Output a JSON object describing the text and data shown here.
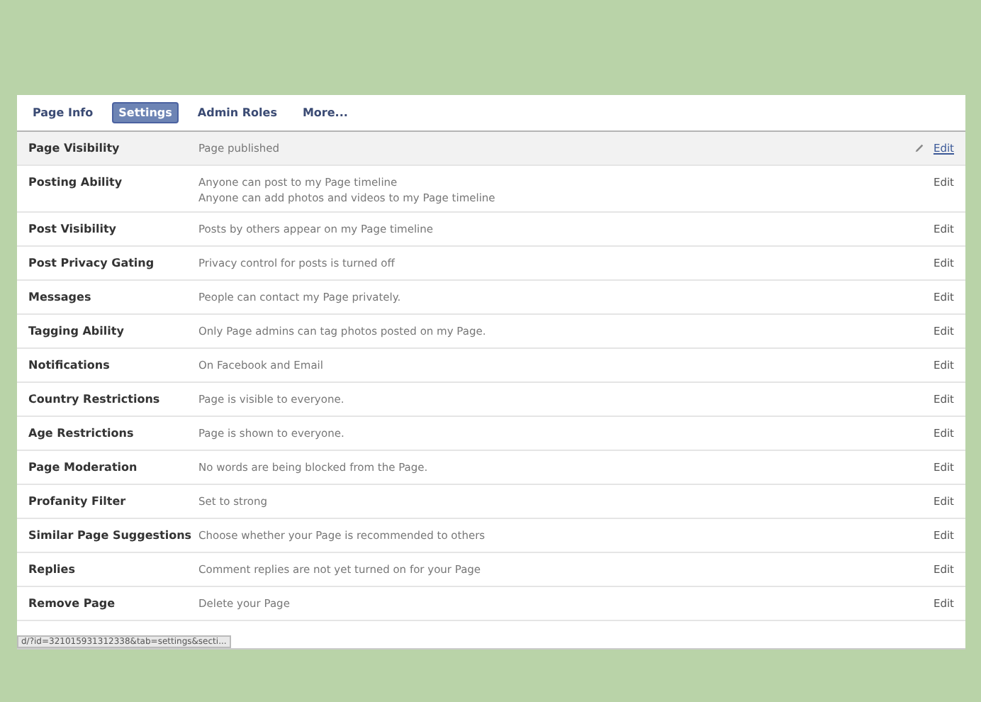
{
  "tabs": [
    {
      "label": "Page Info",
      "selected": false
    },
    {
      "label": "Settings",
      "selected": true
    },
    {
      "label": "Admin Roles",
      "selected": false
    },
    {
      "label": "More...",
      "selected": false
    }
  ],
  "settings": [
    {
      "name": "Page Visibility",
      "lines": [
        "Page published"
      ],
      "action": "Edit",
      "hovered": true
    },
    {
      "name": "Posting Ability",
      "lines": [
        "Anyone can post to my Page timeline",
        "Anyone can add photos and videos to my Page timeline"
      ],
      "action": "Edit",
      "hovered": false
    },
    {
      "name": "Post Visibility",
      "lines": [
        "Posts by others appear on my Page timeline"
      ],
      "action": "Edit",
      "hovered": false
    },
    {
      "name": "Post Privacy Gating",
      "lines": [
        "Privacy control for posts is turned off"
      ],
      "action": "Edit",
      "hovered": false
    },
    {
      "name": "Messages",
      "lines": [
        "People can contact my Page privately."
      ],
      "action": "Edit",
      "hovered": false
    },
    {
      "name": "Tagging Ability",
      "lines": [
        "Only Page admins can tag photos posted on my Page."
      ],
      "action": "Edit",
      "hovered": false
    },
    {
      "name": "Notifications",
      "lines": [
        "On Facebook and Email"
      ],
      "action": "Edit",
      "hovered": false
    },
    {
      "name": "Country Restrictions",
      "lines": [
        "Page is visible to everyone."
      ],
      "action": "Edit",
      "hovered": false
    },
    {
      "name": "Age Restrictions",
      "lines": [
        "Page is shown to everyone."
      ],
      "action": "Edit",
      "hovered": false
    },
    {
      "name": "Page Moderation",
      "lines": [
        "No words are being blocked from the Page."
      ],
      "action": "Edit",
      "hovered": false
    },
    {
      "name": "Profanity Filter",
      "lines": [
        "Set to strong"
      ],
      "action": "Edit",
      "hovered": false
    },
    {
      "name": "Similar Page Suggestions",
      "lines": [
        "Choose whether your Page is recommended to others"
      ],
      "action": "Edit",
      "hovered": false
    },
    {
      "name": "Replies",
      "lines": [
        "Comment replies are not yet turned on for your Page"
      ],
      "action": "Edit",
      "hovered": false
    },
    {
      "name": "Remove Page",
      "lines": [
        "Delete your Page"
      ],
      "action": "Edit",
      "hovered": false
    }
  ],
  "status_url": "d/?id=321015931312338&tab=settings&secti..."
}
